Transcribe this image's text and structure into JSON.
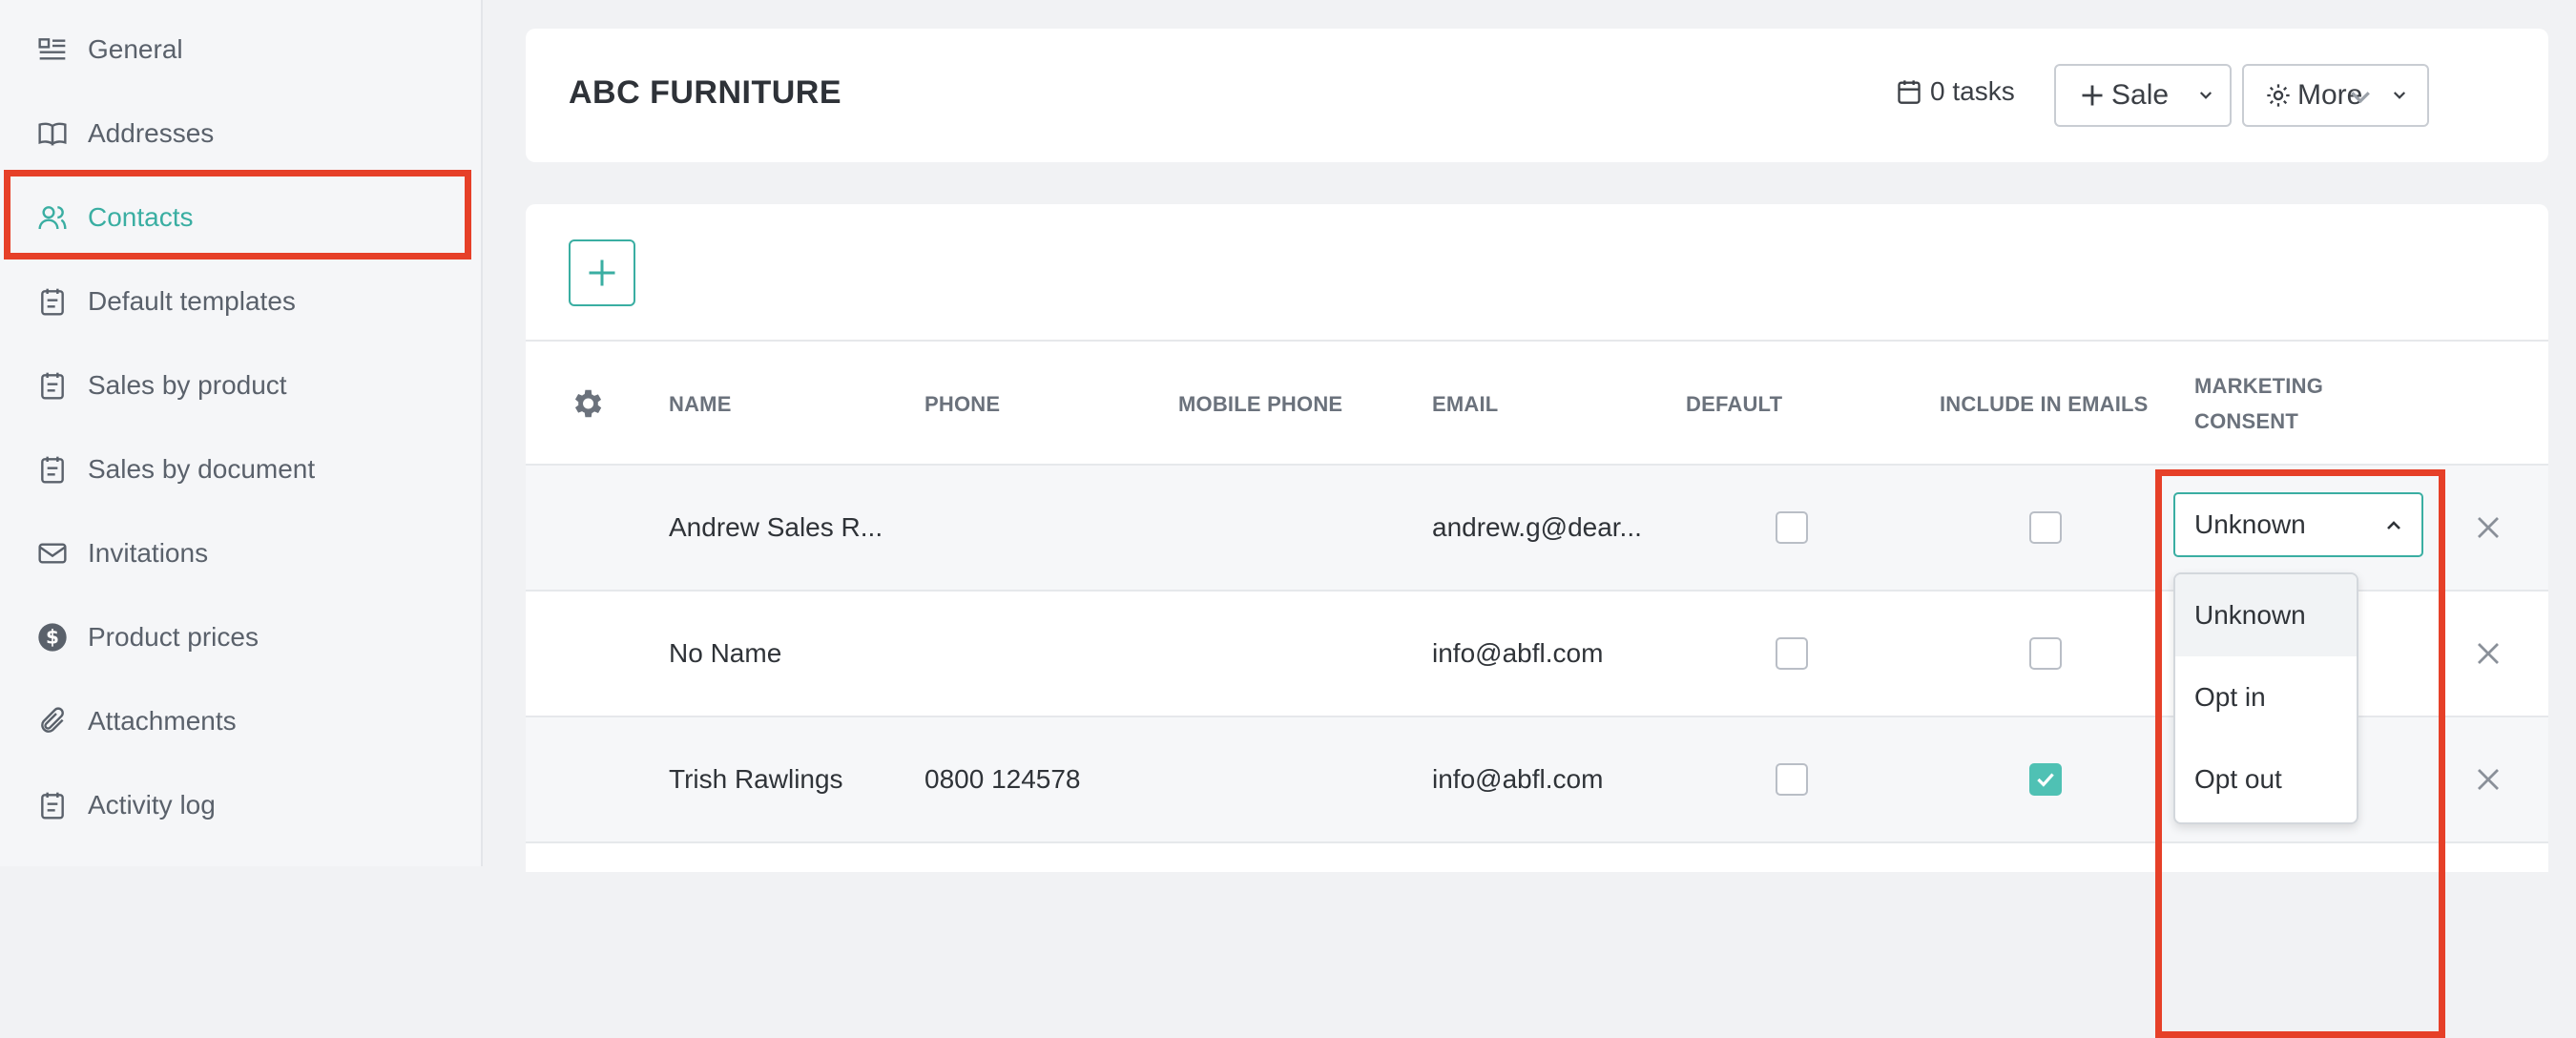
{
  "sidebar": {
    "items": [
      {
        "label": "General",
        "icon": "list-icon"
      },
      {
        "label": "Addresses",
        "icon": "book-icon"
      },
      {
        "label": "Contacts",
        "icon": "users-icon",
        "active": true
      },
      {
        "label": "Default templates",
        "icon": "clipboard-icon"
      },
      {
        "label": "Sales by product",
        "icon": "clipboard-icon"
      },
      {
        "label": "Sales by document",
        "icon": "clipboard-icon"
      },
      {
        "label": "Invitations",
        "icon": "mail-icon"
      },
      {
        "label": "Product prices",
        "icon": "dollar-icon"
      },
      {
        "label": "Attachments",
        "icon": "paperclip-icon"
      },
      {
        "label": "Activity log",
        "icon": "clipboard-icon"
      }
    ]
  },
  "header": {
    "title": "ABC FURNITURE",
    "tasks": "0 tasks",
    "sale_label": "Sale",
    "more_label": "More"
  },
  "table": {
    "columns": {
      "name": "NAME",
      "phone": "PHONE",
      "mobile": "MOBILE PHONE",
      "email": "EMAIL",
      "default": "DEFAULT",
      "include": "INCLUDE IN EMAILS",
      "consent_1": "MARKETING",
      "consent_2": "CONSENT"
    },
    "rows": [
      {
        "name": "Andrew Sales R...",
        "phone": "",
        "mobile": "",
        "email": "andrew.g@dear...",
        "default": false,
        "include": false,
        "consent": "Unknown"
      },
      {
        "name": "No Name",
        "phone": "",
        "mobile": "",
        "email": "info@abfl.com",
        "default": false,
        "include": false,
        "consent": ""
      },
      {
        "name": "Trish Rawlings",
        "phone": "0800 124578",
        "mobile": "",
        "email": "info@abfl.com",
        "default": false,
        "include": true,
        "consent": ""
      }
    ]
  },
  "consent_dropdown": {
    "selected": "Unknown",
    "options": [
      "Unknown",
      "Opt in",
      "Opt out"
    ]
  },
  "colors": {
    "accent": "#3aaea2",
    "highlight": "#e64028",
    "checkbox_on": "#4fc1b4"
  }
}
